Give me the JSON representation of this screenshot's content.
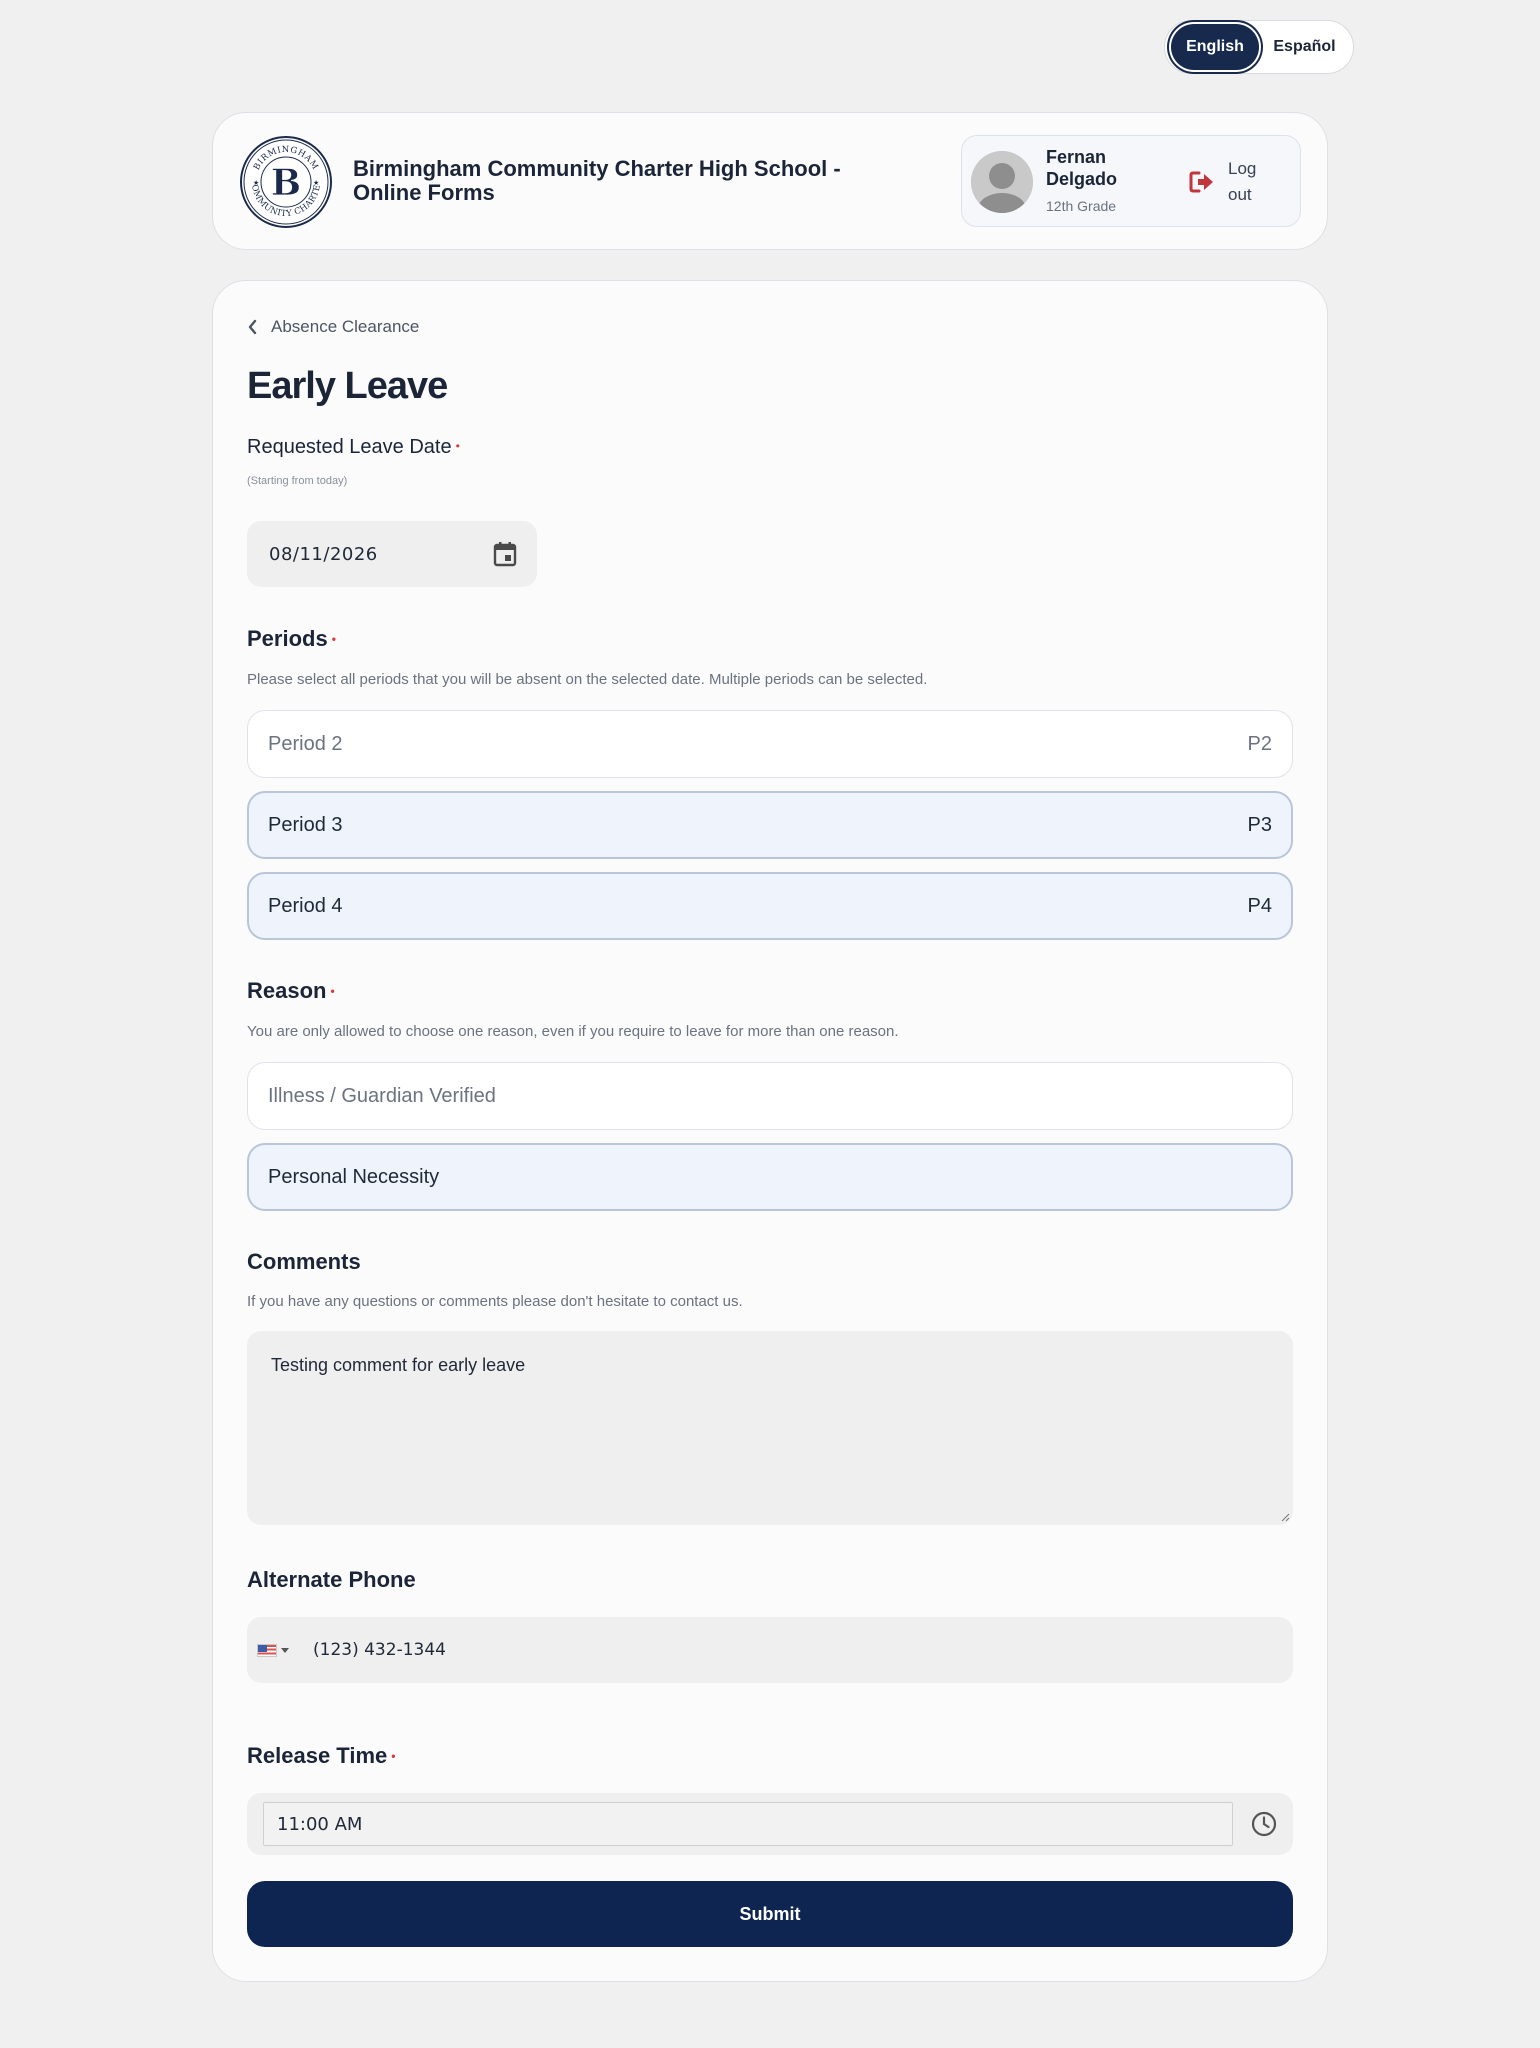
{
  "language": {
    "english": "English",
    "espanol": "Español",
    "active": "English"
  },
  "header": {
    "logo_text_top": "BIRMINGHAM",
    "logo_text_bottom": "COMMUNITY CHARTER",
    "logo_letter": "B",
    "school_title": "Birmingham Community Charter High School - Online Forms",
    "user": {
      "name": "Fernan Delgado",
      "grade": "12th Grade"
    },
    "logout_label": "Log out"
  },
  "form": {
    "back_link": "Absence Clearance",
    "title": "Early Leave",
    "leave_date": {
      "label": "Requested Leave Date",
      "hint": "(Starting from today)",
      "value": "08/11/2026"
    },
    "periods": {
      "label": "Periods",
      "hint": "Please select all periods that you will be absent on the selected date. Multiple periods can be selected.",
      "options": [
        {
          "label": "Period 2",
          "code": "P2",
          "selected": false
        },
        {
          "label": "Period 3",
          "code": "P3",
          "selected": true
        },
        {
          "label": "Period 4",
          "code": "P4",
          "selected": true
        }
      ]
    },
    "reason": {
      "label": "Reason",
      "hint": "You are only allowed to choose one reason, even if you require to leave for more than one reason.",
      "options": [
        {
          "label": "Illness / Guardian Verified",
          "selected": false
        },
        {
          "label": "Personal Necessity",
          "selected": true
        }
      ]
    },
    "comments": {
      "label": "Comments",
      "hint": "If you have any questions or comments please don't hesitate to contact us.",
      "value": "Testing comment for early leave"
    },
    "alternate_phone": {
      "label": "Alternate Phone",
      "country_flag": "us-flag",
      "value": "(123) 432-1344"
    },
    "release_time": {
      "label": "Release Time",
      "value": "11:00 AM"
    },
    "submit_label": "Submit"
  },
  "colors": {
    "primary": "#0e2552",
    "selected_bg": "#eef3fc",
    "selected_border": "#b9c6d9",
    "required": "#d93a3a",
    "logout_icon": "#c0363c"
  }
}
